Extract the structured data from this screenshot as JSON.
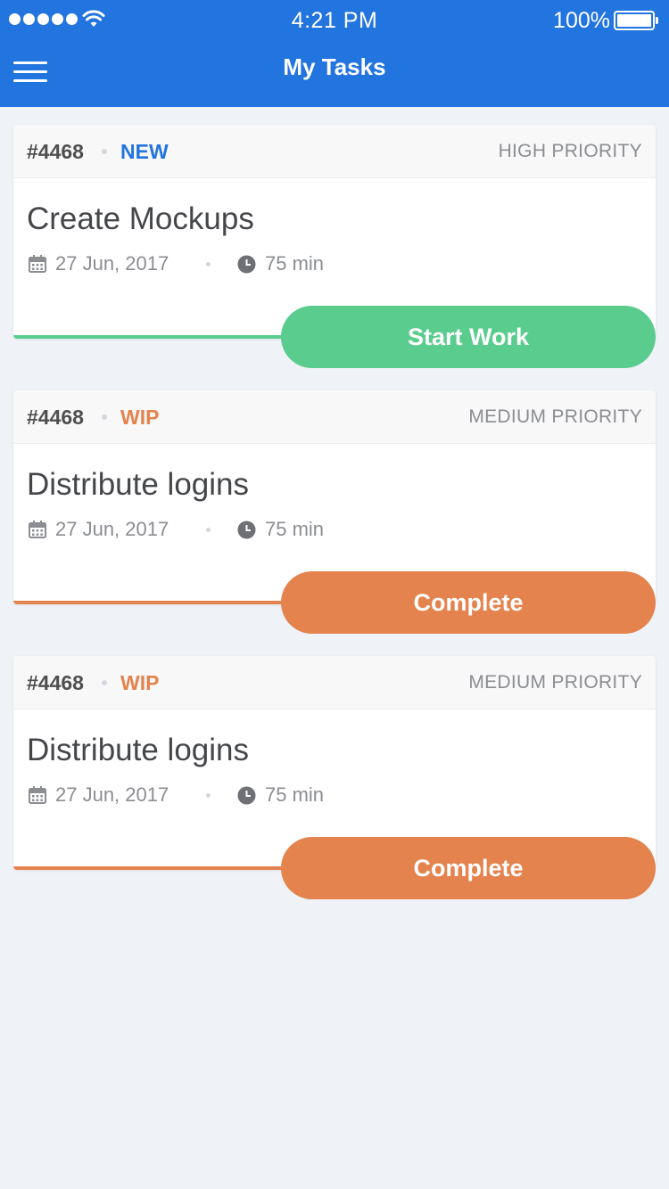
{
  "status_bar": {
    "time": "4:21 PM",
    "battery": "100%"
  },
  "header": {
    "title": "My Tasks",
    "menu_icon": "hamburger-menu-icon",
    "background_color": "#2274de"
  },
  "tasks": [
    {
      "id": "#4468",
      "status": "NEW",
      "status_color": "#2274de",
      "priority": "HIGH PRIORITY",
      "title": "Create Mockups",
      "date": "27 Jun, 2017",
      "duration": "75 min",
      "action_label": "Start Work",
      "action_color": "#5acd8e"
    },
    {
      "id": "#4468",
      "status": "WIP",
      "status_color": "#e4834e",
      "priority": "MEDIUM PRIORITY",
      "title": "Distribute logins",
      "date": "27 Jun, 2017",
      "duration": "75 min",
      "action_label": "Complete",
      "action_color": "#e4834e"
    },
    {
      "id": "#4468",
      "status": "WIP",
      "status_color": "#e4834e",
      "priority": "MEDIUM PRIORITY",
      "title": "Distribute logins",
      "date": "27 Jun, 2017",
      "duration": "75 min",
      "action_label": "Complete",
      "action_color": "#e4834e"
    }
  ],
  "icons": {
    "date": "calendar-icon",
    "duration": "clock-icon"
  }
}
